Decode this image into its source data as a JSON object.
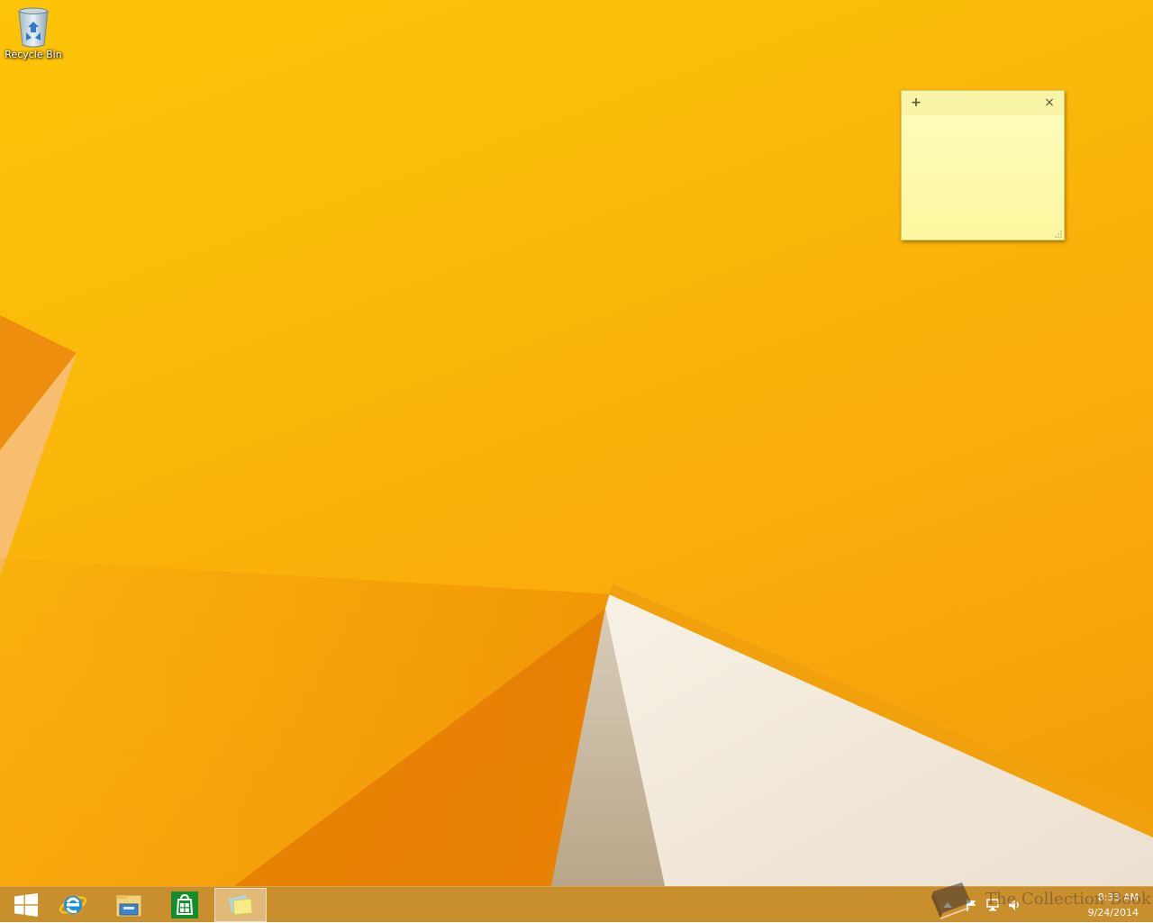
{
  "desktop": {
    "icons": [
      {
        "label": "Recycle Bin",
        "icon": "recycle-bin-icon"
      }
    ]
  },
  "sticky_note": {
    "add_label": "+",
    "close_label": "×",
    "text": ""
  },
  "taskbar": {
    "buttons": [
      {
        "name": "start",
        "icon": "windows-logo-icon"
      },
      {
        "name": "internet-explorer",
        "icon": "internet-explorer-icon"
      },
      {
        "name": "file-explorer",
        "icon": "folder-icon"
      },
      {
        "name": "store",
        "icon": "store-icon"
      },
      {
        "name": "sticky-notes",
        "icon": "sticky-notes-icon",
        "active": true
      }
    ],
    "tray": {
      "icons": [
        "show-hidden-icons-icon",
        "action-center-flag-icon",
        "network-icon",
        "volume-icon"
      ],
      "time": "8:33 AM",
      "date": "9/24/2014"
    }
  },
  "watermark": {
    "text": "The Collection Book"
  },
  "colors": {
    "wallpaper_orange": "#fbb80a",
    "sticky_yellow": "#fdfcc0",
    "taskbar": "#c98f2d"
  }
}
